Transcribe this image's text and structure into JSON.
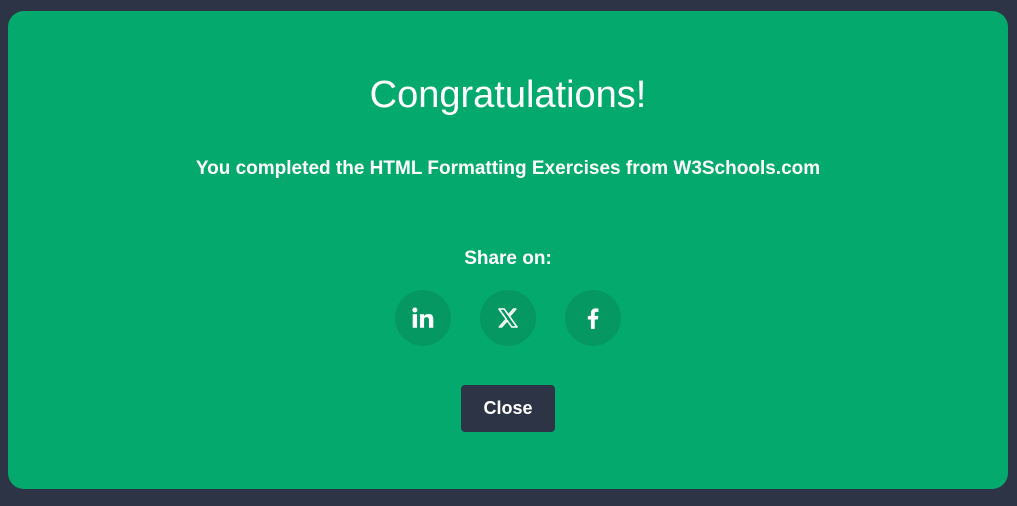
{
  "modal": {
    "title": "Congratulations!",
    "message": "You completed the HTML Formatting Exercises from W3Schools.com",
    "share_label": "Share on:",
    "share_buttons": [
      {
        "icon": "linkedin-icon",
        "network": "LinkedIn"
      },
      {
        "icon": "x-twitter-icon",
        "network": "X"
      },
      {
        "icon": "facebook-icon",
        "network": "Facebook"
      }
    ],
    "close_label": "Close"
  },
  "colors": {
    "backdrop": "#2d3446",
    "modal_background": "#04aa6d",
    "share_button_background": "#059862",
    "close_button_background": "#2d3446",
    "text": "#ffffff"
  }
}
